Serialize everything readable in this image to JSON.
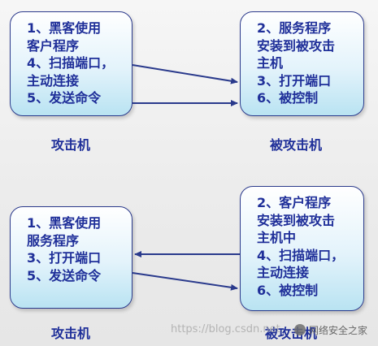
{
  "top": {
    "left_box": {
      "lines": [
        "1、黑客使用",
        "客户程序",
        "4、扫描端口，",
        "主动连接",
        "5、发送命令"
      ]
    },
    "right_box": {
      "lines": [
        "2、服务程序",
        "安装到被攻击",
        "主机",
        "3、打开端口",
        "6、被控制"
      ]
    },
    "left_caption": "攻击机",
    "right_caption": "被攻击机"
  },
  "bottom": {
    "left_box": {
      "lines": [
        "1、黑客使用",
        "服务程序",
        "3、打开端口",
        "5、发送命令"
      ]
    },
    "right_box": {
      "lines": [
        "2、客户程序",
        "安装到被攻击",
        "主机中",
        "4、扫描端口，",
        "主动连接",
        "6、被控制"
      ]
    },
    "left_caption": "攻击机",
    "right_caption": "被攻击机"
  },
  "watermark": {
    "blog_text": "https://blog.csdn.net",
    "brand_text": "网络安全之家"
  },
  "colors": {
    "text": "#1f2f99",
    "border": "#2b3a8c",
    "arrow": "#2a3a8c"
  }
}
